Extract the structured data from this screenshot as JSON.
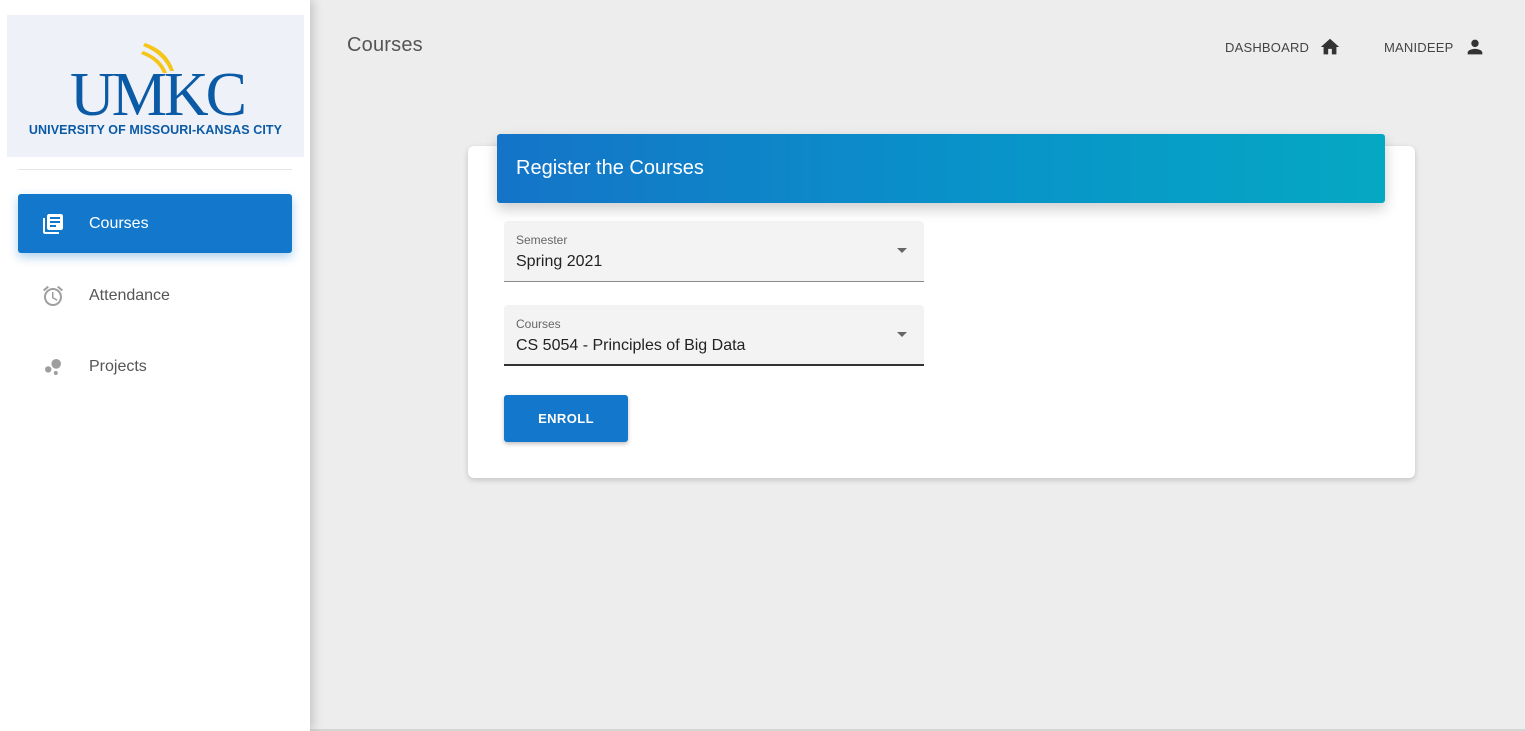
{
  "brand": {
    "logo_text": "UMKC",
    "subtitle": "UNIVERSITY OF MISSOURI-KANSAS CITY",
    "colors": {
      "blue": "#0a5aa6",
      "gold": "#f5c518"
    }
  },
  "sidebar": {
    "items": [
      {
        "label": "Courses",
        "icon": "library-books-icon",
        "active": true
      },
      {
        "label": "Attendance",
        "icon": "alarm-clock-icon",
        "active": false
      },
      {
        "label": "Projects",
        "icon": "bubble-chart-icon",
        "active": false
      }
    ]
  },
  "header": {
    "title": "Courses",
    "dashboard_label": "DASHBOARD",
    "dashboard_icon": "home-icon",
    "user_label": "MANIDEEP",
    "user_icon": "person-icon"
  },
  "card": {
    "title": "Register the Courses",
    "semester": {
      "label": "Semester",
      "value": "Spring 2021"
    },
    "courses": {
      "label": "Courses",
      "value": "CS 5054 - Principles of Big Data"
    },
    "enroll_label": "ENROLL"
  },
  "theme": {
    "primary": "#1378cc",
    "header_gradient_start": "#1574c8",
    "header_gradient_end": "#05a8c3",
    "background": "#ededed"
  }
}
